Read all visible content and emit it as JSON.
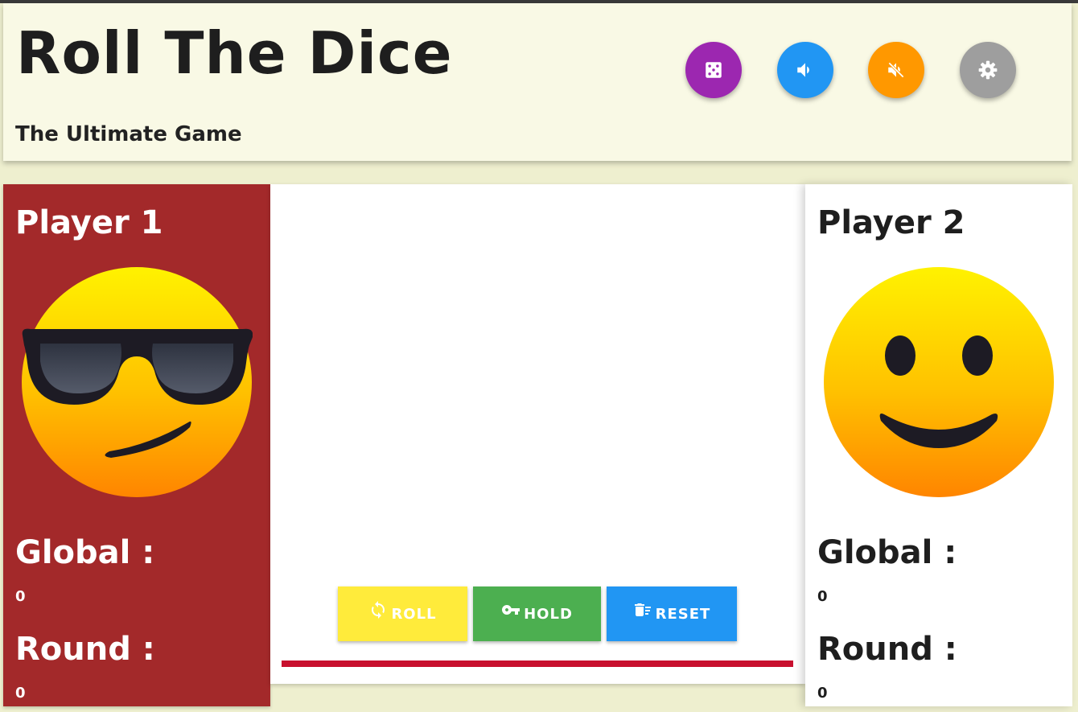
{
  "header": {
    "title": "Roll The Dice",
    "subtitle": "The Ultimate Game",
    "buttons": [
      {
        "icon": "dice-icon",
        "color": "#9c27b0"
      },
      {
        "icon": "volume-up-icon",
        "color": "#2196f3"
      },
      {
        "icon": "volume-mute-icon",
        "color": "#ff9800"
      },
      {
        "icon": "gear-icon",
        "color": "#9e9e9e"
      }
    ]
  },
  "players": [
    {
      "name": "Player 1",
      "avatar": "sunglasses-emoji",
      "active": true,
      "bg": "#a3292a",
      "global_label": "Global :",
      "global_value": "0",
      "round_label": "Round :",
      "round_value": "0"
    },
    {
      "name": "Player 2",
      "avatar": "smiley-emoji",
      "active": false,
      "bg": "#ffffff",
      "global_label": "Global :",
      "global_value": "0",
      "round_label": "Round :",
      "round_value": "0"
    }
  ],
  "controls": {
    "roll": {
      "label": "ROLL",
      "icon": "sync-icon",
      "color": "#ffeb3b"
    },
    "hold": {
      "label": "HOLD",
      "icon": "key-icon",
      "color": "#4caf50"
    },
    "reset": {
      "label": "RESET",
      "icon": "delete-sweep-icon",
      "color": "#2196f3"
    }
  },
  "accent": "#c8102e"
}
